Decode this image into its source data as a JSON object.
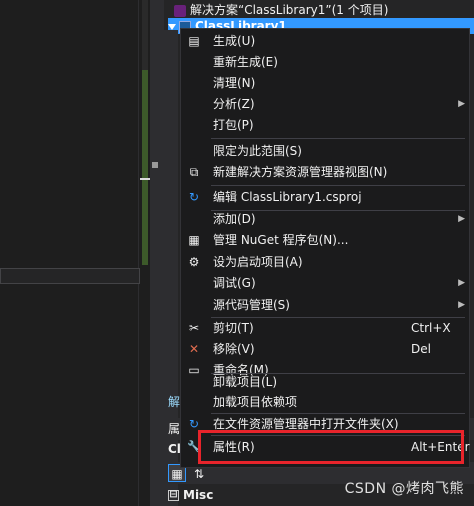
{
  "solution_explorer": {
    "solution_label": "解决方案“ClassLibrary1”(1 个项目)",
    "project_label": "ClassLibrary1",
    "bottom_label_1": "解",
    "bottom_label_2": "属",
    "bottom_label_3": "Cl",
    "misc_label": "Misc",
    "misc_toggle": "⊟"
  },
  "context_menu": {
    "items": [
      {
        "label": "生成(U)",
        "icon": "build-icon",
        "glyph": "▤"
      },
      {
        "label": "重新生成(E)"
      },
      {
        "label": "清理(N)"
      },
      {
        "label": "分析(Z)",
        "submenu": true
      },
      {
        "label": "打包(P)"
      },
      {
        "label": "限定为此范围(S)"
      },
      {
        "label": "新建解决方案资源管理器视图(N)",
        "icon": "new-view-icon",
        "glyph": "⧉"
      },
      {
        "label": "编辑 ClassLibrary1.csproj",
        "icon": "edit-refresh-icon",
        "glyph": "↻"
      },
      {
        "label": "添加(D)",
        "submenu": true
      },
      {
        "label": "管理 NuGet 程序包(N)...",
        "icon": "nuget-icon",
        "glyph": "▦"
      },
      {
        "label": "设为启动项目(A)",
        "icon": "gear-icon",
        "glyph": "⚙"
      },
      {
        "label": "调试(G)",
        "submenu": true
      },
      {
        "label": "源代码管理(S)",
        "submenu": true
      },
      {
        "label": "剪切(T)",
        "shortcut": "Ctrl+X",
        "icon": "scissors-icon",
        "glyph": "✂"
      },
      {
        "label": "移除(V)",
        "shortcut": "Del",
        "icon": "remove-icon",
        "glyph": "✕",
        "color": "#e06c4f"
      },
      {
        "label": "重命名(M)",
        "icon": "rename-icon",
        "glyph": "▭"
      },
      {
        "label": "卸载项目(L)"
      },
      {
        "label": "加载项目依赖项"
      },
      {
        "label": "在文件资源管理器中打开文件夹(X)",
        "icon": "open-folder-icon",
        "glyph": "↻"
      },
      {
        "label": "属性(R)",
        "shortcut": "Alt+Enter",
        "icon": "wrench-icon",
        "glyph": "🔧"
      }
    ]
  },
  "watermark": "CSDN @烤肉飞熊",
  "colors": {
    "selection": "#3399ff",
    "highlight_box": "#e8242b",
    "menu_bg": "#1b1b1c"
  }
}
